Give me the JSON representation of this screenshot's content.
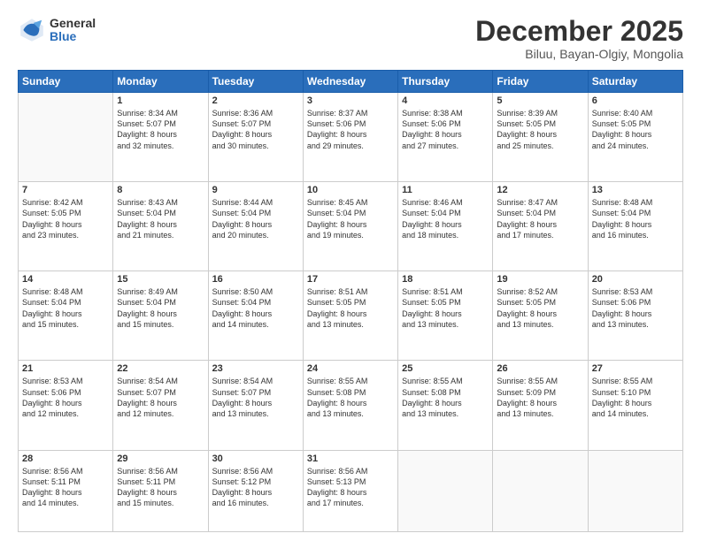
{
  "logo": {
    "general": "General",
    "blue": "Blue"
  },
  "title": "December 2025",
  "location": "Biluu, Bayan-Olgiy, Mongolia",
  "days_header": [
    "Sunday",
    "Monday",
    "Tuesday",
    "Wednesday",
    "Thursday",
    "Friday",
    "Saturday"
  ],
  "weeks": [
    [
      {
        "day": "",
        "info": ""
      },
      {
        "day": "1",
        "info": "Sunrise: 8:34 AM\nSunset: 5:07 PM\nDaylight: 8 hours\nand 32 minutes."
      },
      {
        "day": "2",
        "info": "Sunrise: 8:36 AM\nSunset: 5:07 PM\nDaylight: 8 hours\nand 30 minutes."
      },
      {
        "day": "3",
        "info": "Sunrise: 8:37 AM\nSunset: 5:06 PM\nDaylight: 8 hours\nand 29 minutes."
      },
      {
        "day": "4",
        "info": "Sunrise: 8:38 AM\nSunset: 5:06 PM\nDaylight: 8 hours\nand 27 minutes."
      },
      {
        "day": "5",
        "info": "Sunrise: 8:39 AM\nSunset: 5:05 PM\nDaylight: 8 hours\nand 25 minutes."
      },
      {
        "day": "6",
        "info": "Sunrise: 8:40 AM\nSunset: 5:05 PM\nDaylight: 8 hours\nand 24 minutes."
      }
    ],
    [
      {
        "day": "7",
        "info": "Sunrise: 8:42 AM\nSunset: 5:05 PM\nDaylight: 8 hours\nand 23 minutes."
      },
      {
        "day": "8",
        "info": "Sunrise: 8:43 AM\nSunset: 5:04 PM\nDaylight: 8 hours\nand 21 minutes."
      },
      {
        "day": "9",
        "info": "Sunrise: 8:44 AM\nSunset: 5:04 PM\nDaylight: 8 hours\nand 20 minutes."
      },
      {
        "day": "10",
        "info": "Sunrise: 8:45 AM\nSunset: 5:04 PM\nDaylight: 8 hours\nand 19 minutes."
      },
      {
        "day": "11",
        "info": "Sunrise: 8:46 AM\nSunset: 5:04 PM\nDaylight: 8 hours\nand 18 minutes."
      },
      {
        "day": "12",
        "info": "Sunrise: 8:47 AM\nSunset: 5:04 PM\nDaylight: 8 hours\nand 17 minutes."
      },
      {
        "day": "13",
        "info": "Sunrise: 8:48 AM\nSunset: 5:04 PM\nDaylight: 8 hours\nand 16 minutes."
      }
    ],
    [
      {
        "day": "14",
        "info": "Sunrise: 8:48 AM\nSunset: 5:04 PM\nDaylight: 8 hours\nand 15 minutes."
      },
      {
        "day": "15",
        "info": "Sunrise: 8:49 AM\nSunset: 5:04 PM\nDaylight: 8 hours\nand 15 minutes."
      },
      {
        "day": "16",
        "info": "Sunrise: 8:50 AM\nSunset: 5:04 PM\nDaylight: 8 hours\nand 14 minutes."
      },
      {
        "day": "17",
        "info": "Sunrise: 8:51 AM\nSunset: 5:05 PM\nDaylight: 8 hours\nand 13 minutes."
      },
      {
        "day": "18",
        "info": "Sunrise: 8:51 AM\nSunset: 5:05 PM\nDaylight: 8 hours\nand 13 minutes."
      },
      {
        "day": "19",
        "info": "Sunrise: 8:52 AM\nSunset: 5:05 PM\nDaylight: 8 hours\nand 13 minutes."
      },
      {
        "day": "20",
        "info": "Sunrise: 8:53 AM\nSunset: 5:06 PM\nDaylight: 8 hours\nand 13 minutes."
      }
    ],
    [
      {
        "day": "21",
        "info": "Sunrise: 8:53 AM\nSunset: 5:06 PM\nDaylight: 8 hours\nand 12 minutes."
      },
      {
        "day": "22",
        "info": "Sunrise: 8:54 AM\nSunset: 5:07 PM\nDaylight: 8 hours\nand 12 minutes."
      },
      {
        "day": "23",
        "info": "Sunrise: 8:54 AM\nSunset: 5:07 PM\nDaylight: 8 hours\nand 13 minutes."
      },
      {
        "day": "24",
        "info": "Sunrise: 8:55 AM\nSunset: 5:08 PM\nDaylight: 8 hours\nand 13 minutes."
      },
      {
        "day": "25",
        "info": "Sunrise: 8:55 AM\nSunset: 5:08 PM\nDaylight: 8 hours\nand 13 minutes."
      },
      {
        "day": "26",
        "info": "Sunrise: 8:55 AM\nSunset: 5:09 PM\nDaylight: 8 hours\nand 13 minutes."
      },
      {
        "day": "27",
        "info": "Sunrise: 8:55 AM\nSunset: 5:10 PM\nDaylight: 8 hours\nand 14 minutes."
      }
    ],
    [
      {
        "day": "28",
        "info": "Sunrise: 8:56 AM\nSunset: 5:11 PM\nDaylight: 8 hours\nand 14 minutes."
      },
      {
        "day": "29",
        "info": "Sunrise: 8:56 AM\nSunset: 5:11 PM\nDaylight: 8 hours\nand 15 minutes."
      },
      {
        "day": "30",
        "info": "Sunrise: 8:56 AM\nSunset: 5:12 PM\nDaylight: 8 hours\nand 16 minutes."
      },
      {
        "day": "31",
        "info": "Sunrise: 8:56 AM\nSunset: 5:13 PM\nDaylight: 8 hours\nand 17 minutes."
      },
      {
        "day": "",
        "info": ""
      },
      {
        "day": "",
        "info": ""
      },
      {
        "day": "",
        "info": ""
      }
    ]
  ]
}
